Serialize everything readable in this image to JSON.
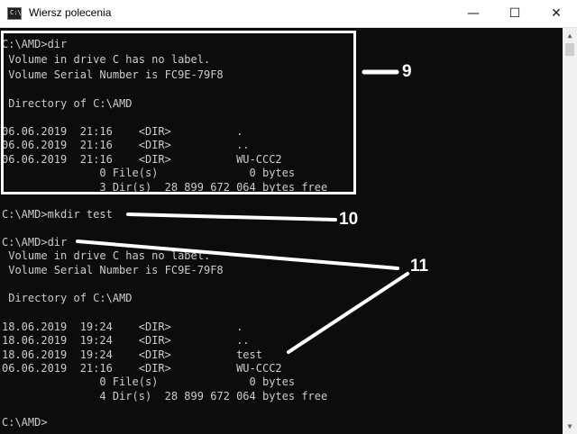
{
  "window": {
    "title": "Wiersz polecenia",
    "icon_text": "C:\\.",
    "min_glyph": "—",
    "max_glyph": "☐",
    "close_glyph": "✕"
  },
  "console": {
    "lines": [
      "C:\\AMD>dir",
      " Volume in drive C has no label.",
      " Volume Serial Number is FC9E-79F8",
      "",
      " Directory of C:\\AMD",
      "",
      "06.06.2019  21:16    <DIR>          .",
      "06.06.2019  21:16    <DIR>          ..",
      "06.06.2019  21:16    <DIR>          WU-CCC2",
      "               0 File(s)              0 bytes",
      "               3 Dir(s)  28 899 672 064 bytes free",
      "",
      "C:\\AMD>mkdir test",
      "",
      "C:\\AMD>dir",
      " Volume in drive C has no label.",
      " Volume Serial Number is FC9E-79F8",
      "",
      " Directory of C:\\AMD",
      "",
      "18.06.2019  19:24    <DIR>          .",
      "18.06.2019  19:24    <DIR>          ..",
      "18.06.2019  19:24    <DIR>          test",
      "06.06.2019  21:16    <DIR>          WU-CCC2",
      "               0 File(s)              0 bytes",
      "               4 Dir(s)  28 899 672 064 bytes free",
      "",
      "C:\\AMD>"
    ]
  },
  "annotations": {
    "label_9": "9",
    "label_10": "10",
    "label_11": "11"
  },
  "colors": {
    "console_bg": "#0c0c0c",
    "console_text": "#cccccc",
    "annotation": "#ffffff"
  }
}
